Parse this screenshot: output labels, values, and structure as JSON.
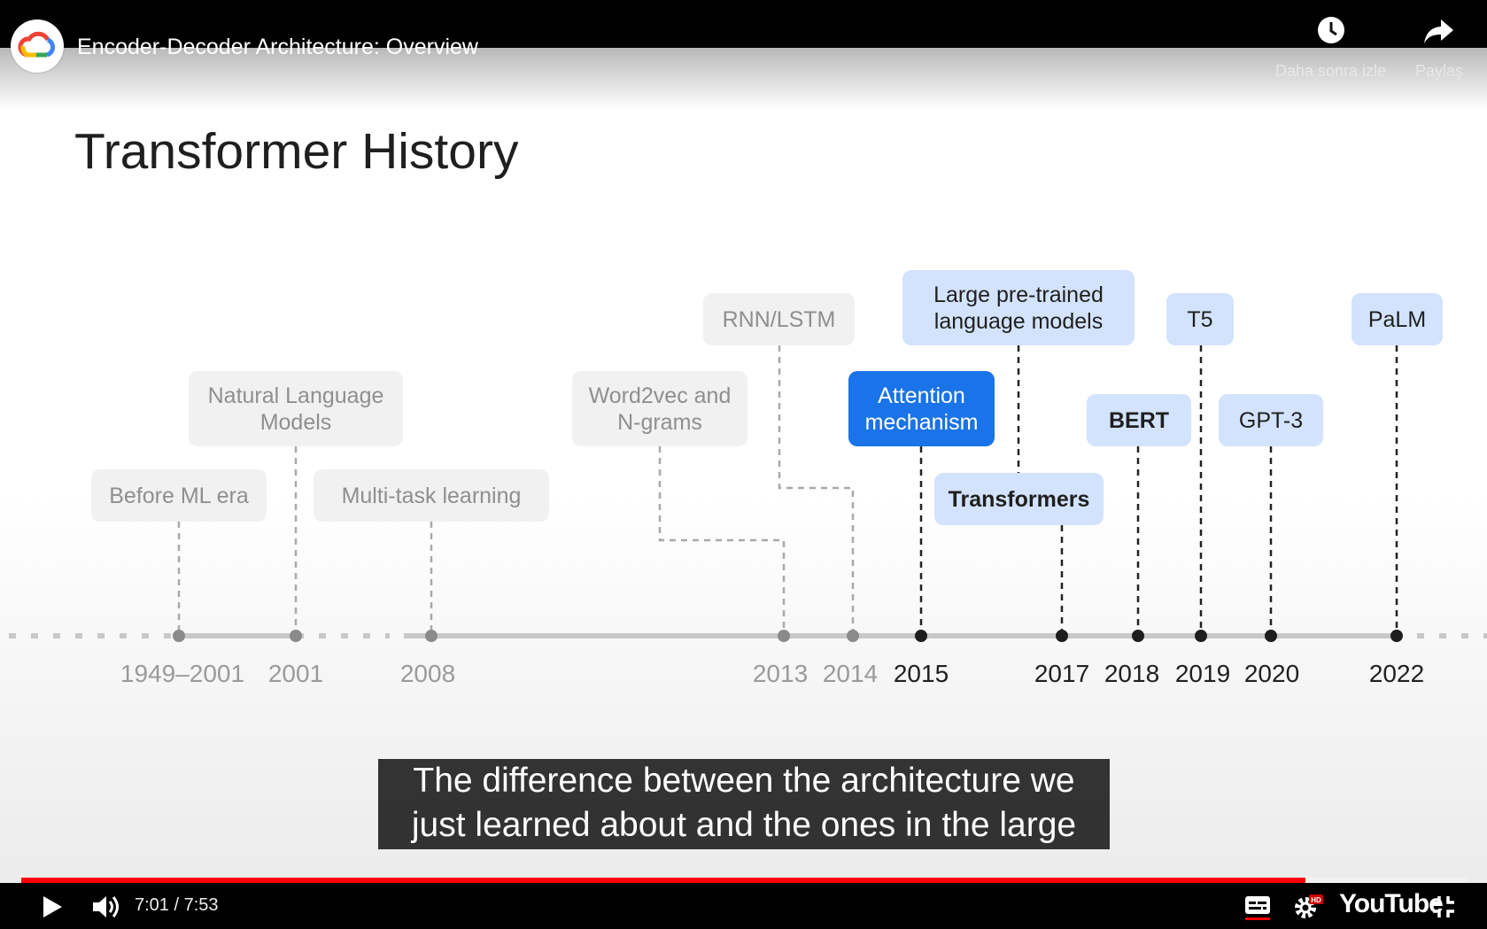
{
  "player": {
    "video_title": "Encoder-Decoder Architecture: Overview",
    "watch_later_label": "Daha sonra izle",
    "share_label": "Paylaş",
    "current_time": "7:01",
    "duration": "7:53",
    "time_display": "7:01 / 7:53",
    "progress_fraction": 0.888,
    "quality_badge": "HD",
    "brand": "YouTube",
    "colors": {
      "progress": "#ff0000",
      "bar_bg": "#000000"
    }
  },
  "slide": {
    "title": "Transformer History",
    "events": [
      {
        "label": [
          "Before ML era"
        ],
        "year": "1949–2001",
        "style": "past"
      },
      {
        "label": [
          "Natural Language",
          "Models"
        ],
        "year": "2001",
        "style": "past"
      },
      {
        "label": [
          "Multi-task learning"
        ],
        "year": "2008",
        "style": "past"
      },
      {
        "label": [
          "Word2vec and",
          "N-grams"
        ],
        "year": "2013",
        "style": "past"
      },
      {
        "label": [
          "RNN/LSTM"
        ],
        "year": "2014",
        "style": "past"
      },
      {
        "label": [
          "Attention",
          "mechanism"
        ],
        "year": "2015",
        "style": "highlight"
      },
      {
        "label": [
          "Transformers"
        ],
        "year": "2017",
        "style": "current-bold"
      },
      {
        "label": [
          "Large pre-trained",
          "language models"
        ],
        "year": "",
        "style": "current"
      },
      {
        "label": [
          "BERT"
        ],
        "year": "2018",
        "style": "current-bold"
      },
      {
        "label": [
          "T5"
        ],
        "year": "2019",
        "style": "current"
      },
      {
        "label": [
          "GPT-3"
        ],
        "year": "2020",
        "style": "current"
      },
      {
        "label": [
          "PaLM"
        ],
        "year": "2022",
        "style": "current"
      }
    ],
    "colors": {
      "highlight": "#1a73e8",
      "current": "#d3e3fd",
      "past": "#f1f1f1"
    }
  },
  "captions": {
    "line1": "The difference between the architecture we",
    "line2": "just learned about and the ones in the large"
  }
}
